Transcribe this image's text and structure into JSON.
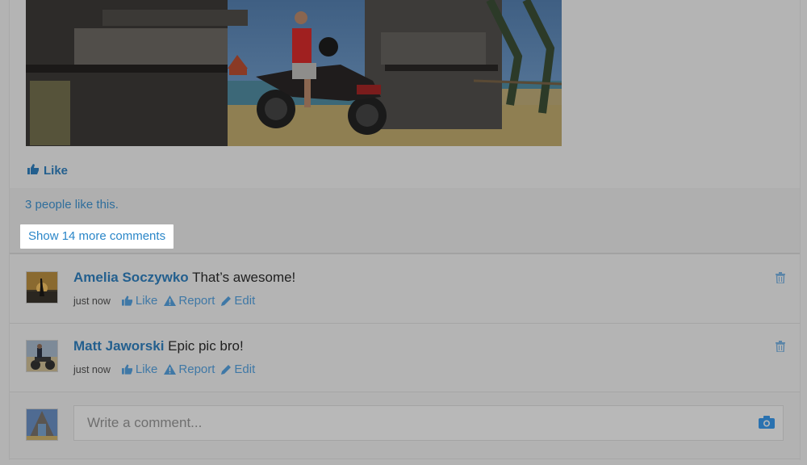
{
  "post": {
    "photo_alt": "Man in red shirt sitting on a motorcycle between temple gate pillars by the beach",
    "like_label": "Like",
    "likes_text": "3 people like this.",
    "show_more_label": "Show 14 more comments"
  },
  "comments": [
    {
      "author": "Amelia Soczywko",
      "text": "That’s awesome!",
      "time": "just now",
      "like_label": "Like",
      "report_label": "Report",
      "edit_label": "Edit",
      "avatar_icon": "sunset-silhouette-avatar"
    },
    {
      "author": "Matt Jaworski",
      "text": "Epic pic bro!",
      "time": "just now",
      "like_label": "Like",
      "report_label": "Report",
      "edit_label": "Edit",
      "avatar_icon": "motorcycle-rider-avatar"
    }
  ],
  "composer": {
    "placeholder": "Write a comment...",
    "value": "",
    "camera_icon": "camera-icon"
  },
  "colors": {
    "link": "#235f8e",
    "highlight_link": "#2a86c8",
    "overlay_bg": "#b3b3b3"
  }
}
